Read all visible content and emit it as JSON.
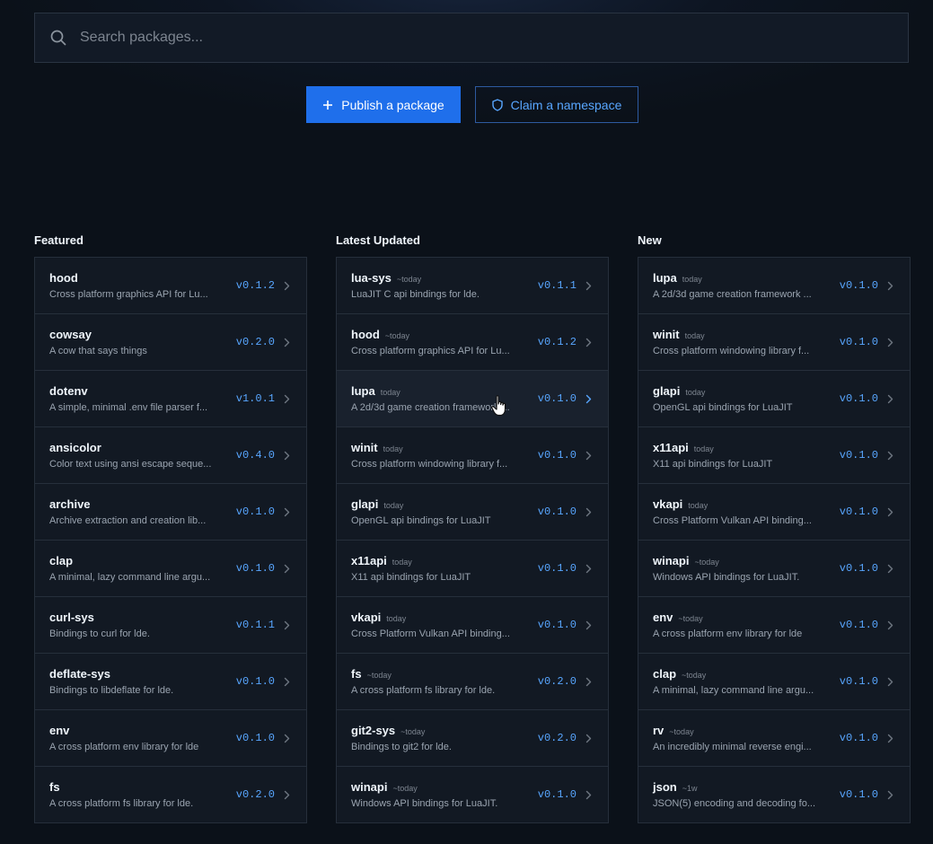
{
  "search": {
    "placeholder": "Search packages..."
  },
  "actions": {
    "publish_label": "Publish a package",
    "claim_label": "Claim a namespace"
  },
  "icons": {
    "search": "search-icon",
    "publish": "plus-icon",
    "claim": "shield-icon",
    "row": "chevron-right-icon",
    "cursor": "hand-pointer-icon"
  },
  "colors": {
    "accent": "#1f6feb",
    "link": "#58a6ff",
    "background": "#0b1119"
  },
  "columns": [
    {
      "title": "Featured",
      "items": [
        {
          "name": "hood",
          "time": "",
          "desc": "Cross platform graphics API for Lu...",
          "version": "v0.1.2"
        },
        {
          "name": "cowsay",
          "time": "",
          "desc": "A cow that says things",
          "version": "v0.2.0"
        },
        {
          "name": "dotenv",
          "time": "",
          "desc": "A simple, minimal .env file parser f...",
          "version": "v1.0.1"
        },
        {
          "name": "ansicolor",
          "time": "",
          "desc": "Color text using ansi escape seque...",
          "version": "v0.4.0"
        },
        {
          "name": "archive",
          "time": "",
          "desc": "Archive extraction and creation lib...",
          "version": "v0.1.0"
        },
        {
          "name": "clap",
          "time": "",
          "desc": "A minimal, lazy command line argu...",
          "version": "v0.1.0"
        },
        {
          "name": "curl-sys",
          "time": "",
          "desc": "Bindings to curl for lde.",
          "version": "v0.1.1"
        },
        {
          "name": "deflate-sys",
          "time": "",
          "desc": "Bindings to libdeflate for lde.",
          "version": "v0.1.0"
        },
        {
          "name": "env",
          "time": "",
          "desc": "A cross platform env library for lde",
          "version": "v0.1.0"
        },
        {
          "name": "fs",
          "time": "",
          "desc": "A cross platform fs library for lde.",
          "version": "v0.2.0"
        }
      ]
    },
    {
      "title": "Latest Updated",
      "items": [
        {
          "name": "lua-sys",
          "time": "~today",
          "desc": "LuaJIT C api bindings for lde.",
          "version": "v0.1.1"
        },
        {
          "name": "hood",
          "time": "~today",
          "desc": "Cross platform graphics API for Lu...",
          "version": "v0.1.2"
        },
        {
          "name": "lupa",
          "time": "today",
          "desc": "A 2d/3d game creation framework ...",
          "version": "v0.1.0"
        },
        {
          "name": "winit",
          "time": "today",
          "desc": "Cross platform windowing library f...",
          "version": "v0.1.0"
        },
        {
          "name": "glapi",
          "time": "today",
          "desc": "OpenGL api bindings for LuaJIT",
          "version": "v0.1.0"
        },
        {
          "name": "x11api",
          "time": "today",
          "desc": "X11 api bindings for LuaJIT",
          "version": "v0.1.0"
        },
        {
          "name": "vkapi",
          "time": "today",
          "desc": "Cross Platform Vulkan API binding...",
          "version": "v0.1.0"
        },
        {
          "name": "fs",
          "time": "~today",
          "desc": "A cross platform fs library for lde.",
          "version": "v0.2.0"
        },
        {
          "name": "git2-sys",
          "time": "~today",
          "desc": "Bindings to git2 for lde.",
          "version": "v0.2.0"
        },
        {
          "name": "winapi",
          "time": "~today",
          "desc": "Windows API bindings for LuaJIT.",
          "version": "v0.1.0"
        }
      ]
    },
    {
      "title": "New",
      "items": [
        {
          "name": "lupa",
          "time": "today",
          "desc": "A 2d/3d game creation framework ...",
          "version": "v0.1.0"
        },
        {
          "name": "winit",
          "time": "today",
          "desc": "Cross platform windowing library f...",
          "version": "v0.1.0"
        },
        {
          "name": "glapi",
          "time": "today",
          "desc": "OpenGL api bindings for LuaJIT",
          "version": "v0.1.0"
        },
        {
          "name": "x11api",
          "time": "today",
          "desc": "X11 api bindings for LuaJIT",
          "version": "v0.1.0"
        },
        {
          "name": "vkapi",
          "time": "today",
          "desc": "Cross Platform Vulkan API binding...",
          "version": "v0.1.0"
        },
        {
          "name": "winapi",
          "time": "~today",
          "desc": "Windows API bindings for LuaJIT.",
          "version": "v0.1.0"
        },
        {
          "name": "env",
          "time": "~today",
          "desc": "A cross platform env library for lde",
          "version": "v0.1.0"
        },
        {
          "name": "clap",
          "time": "~today",
          "desc": "A minimal, lazy command line argu...",
          "version": "v0.1.0"
        },
        {
          "name": "rv",
          "time": "~today",
          "desc": "An incredibly minimal reverse engi...",
          "version": "v0.1.0"
        },
        {
          "name": "json",
          "time": "~1w",
          "desc": "JSON(5) encoding and decoding fo...",
          "version": "v0.1.0"
        }
      ]
    }
  ]
}
